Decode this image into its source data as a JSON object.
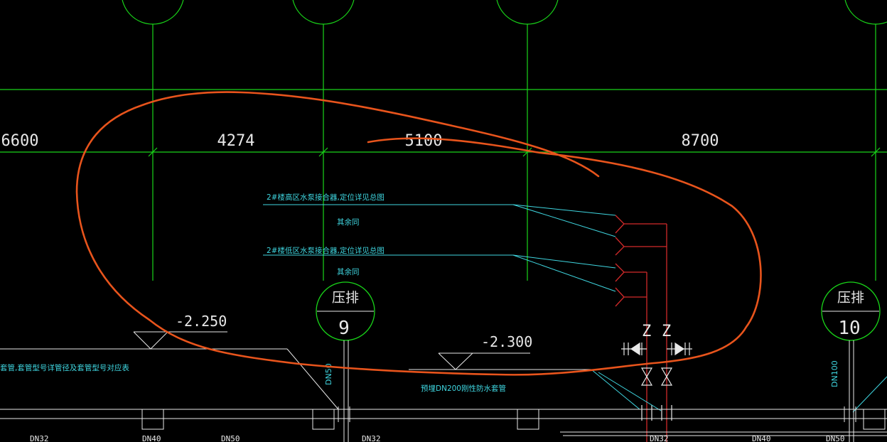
{
  "dimensions": [
    "6600",
    "4274",
    "5100",
    "8700"
  ],
  "annotations": {
    "high_zone": "2#楼高区水泵接合器,定位详见总图",
    "same_1": "其余同",
    "low_zone": "2#楼低区水泵接合器,定位详见总图",
    "same_2": "其余同",
    "sleeve_table": "套管,套管型号详管径及套管型号对应表",
    "waterproof_sleeve": "预埋DN200刚性防水套管"
  },
  "elevations": [
    "-2.250",
    "-2.300"
  ],
  "drains": [
    {
      "label": "压排",
      "number": "9"
    },
    {
      "label": "压排",
      "number": "10"
    }
  ],
  "valve_tags": [
    "Z",
    "Z"
  ],
  "pipe_sizes": {
    "vertical_left": "DN50",
    "vertical_right": "DN100",
    "bottom": [
      "DN32",
      "DN40",
      "DN50",
      "DN32",
      "DN32",
      "DN40",
      "DN50"
    ]
  },
  "colors": {
    "grid": "#19d419",
    "leader": "#3fd6e0",
    "pipe": "#d22a2a",
    "markup": "#e8541c",
    "text": "#e8e8e8",
    "bg": "#000000"
  }
}
